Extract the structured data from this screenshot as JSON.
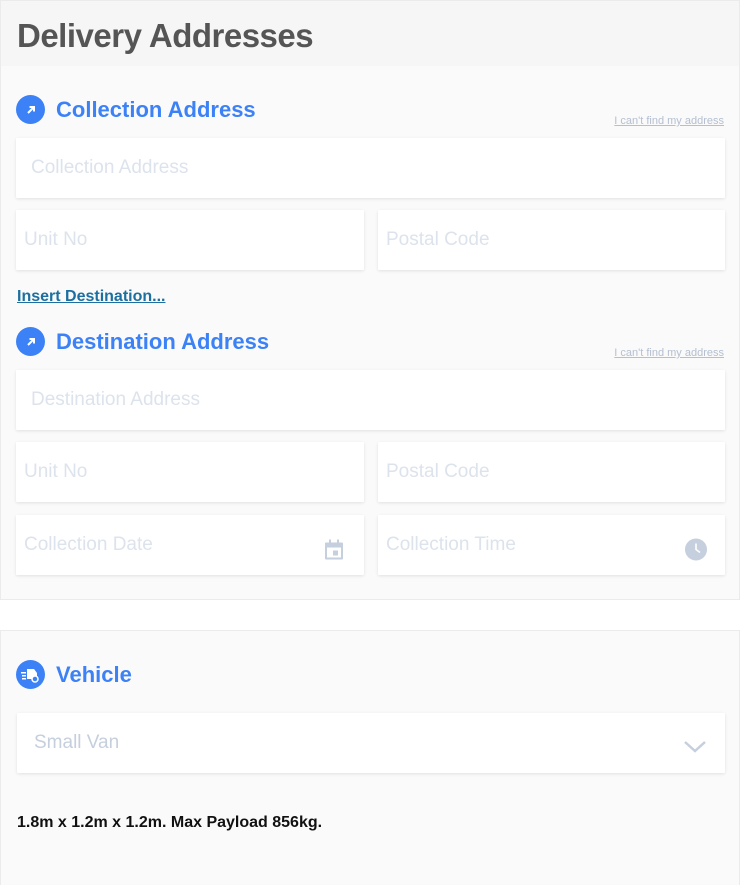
{
  "header": {
    "title": "Delivery Addresses"
  },
  "collection": {
    "title": "Collection Address",
    "cant_find": "I can't find my address",
    "address_placeholder": "Collection Address",
    "unit_placeholder": "Unit No",
    "postal_placeholder": "Postal Code"
  },
  "insert_destination": "Insert Destination...",
  "destination": {
    "title": "Destination Address",
    "cant_find": "I can't find my address",
    "address_placeholder": "Destination Address",
    "unit_placeholder": "Unit No",
    "postal_placeholder": "Postal Code",
    "date_placeholder": "Collection Date",
    "time_placeholder": "Collection Time"
  },
  "vehicle": {
    "title": "Vehicle",
    "selected": "Small Van",
    "description": "1.8m x 1.2m x 1.2m. Max Payload 856kg."
  },
  "colors": {
    "accent": "#3c82f6",
    "link": "#1c6fa0",
    "placeholder": "#dde3ec"
  }
}
